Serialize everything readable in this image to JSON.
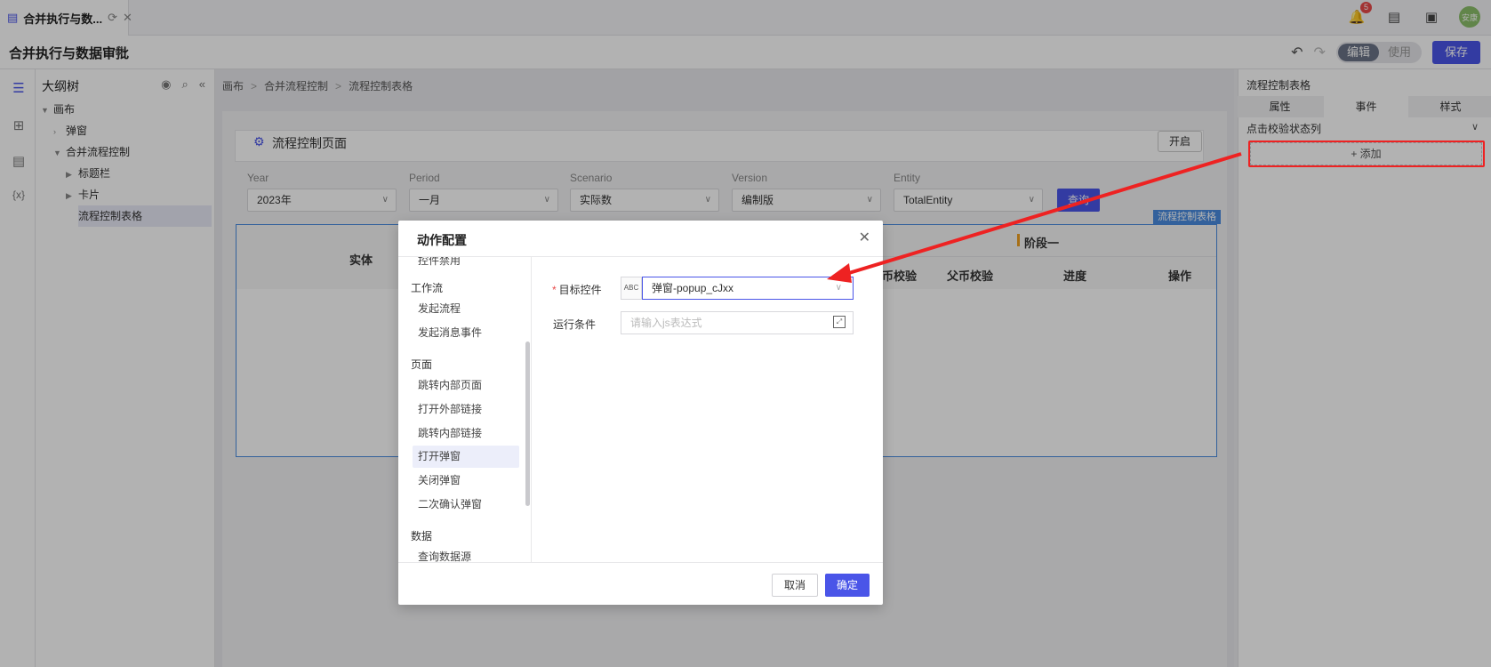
{
  "tab": {
    "label": "合并执行与数...",
    "refresh_icon": "refresh-icon",
    "close_icon": "close-icon"
  },
  "topbar": {
    "notification_count": "5",
    "avatar_text": "安康"
  },
  "header": {
    "title": "合并执行与数据审批",
    "mode_edit": "编辑",
    "mode_use": "使用",
    "save_label": "保存"
  },
  "outline": {
    "title": "大纲树",
    "items": [
      {
        "label": "画布"
      },
      {
        "label": "弹窗"
      },
      {
        "label": "合并流程控制"
      },
      {
        "label": "标题栏"
      },
      {
        "label": "卡片"
      },
      {
        "label": "流程控制表格"
      }
    ]
  },
  "breadcrumb": {
    "items": [
      "画布",
      "合并流程控制",
      "流程控制表格"
    ]
  },
  "page": {
    "title": "流程控制页面",
    "open_label": "开启",
    "filters": [
      {
        "label": "Year",
        "value": "2023年"
      },
      {
        "label": "Period",
        "value": "一月"
      },
      {
        "label": "Scenario",
        "value": "实际数"
      },
      {
        "label": "Version",
        "value": "编制版"
      },
      {
        "label": "Entity",
        "value": "TotalEntity"
      }
    ],
    "query_label": "查询",
    "table_tag": "流程控制表格",
    "table_headers": {
      "entity": "实体",
      "stage": "阶段一",
      "currency_check": "币校验",
      "parent_currency_check": "父币校验",
      "progress": "进度",
      "action": "操作"
    }
  },
  "modal": {
    "title": "动作配置",
    "left_cut_item": "控件禁用",
    "groups": [
      {
        "title": "工作流",
        "items": [
          "发起流程",
          "发起消息事件"
        ]
      },
      {
        "title": "页面",
        "items": [
          "跳转内部页面",
          "打开外部链接",
          "跳转内部链接",
          "打开弹窗",
          "关闭弹窗",
          "二次确认弹窗"
        ]
      },
      {
        "title": "数据",
        "items": [
          "查询数据源"
        ]
      }
    ],
    "selected_item": "打开弹窗",
    "target_label": "目标控件",
    "target_type": "ABC",
    "target_value": "弹窗-popup_cJxx",
    "condition_label": "运行条件",
    "condition_placeholder": "请输入js表达式",
    "cancel_label": "取消",
    "ok_label": "确定"
  },
  "right_panel": {
    "title": "流程控制表格",
    "tabs": [
      "属性",
      "事件",
      "样式"
    ],
    "active_tab": "事件",
    "section": "点击校验状态列",
    "add_label": "+ 添加"
  },
  "colors": {
    "accent": "#4a55e8",
    "annotation_red": "#ee2222",
    "stage_bar": "#f0a020"
  }
}
